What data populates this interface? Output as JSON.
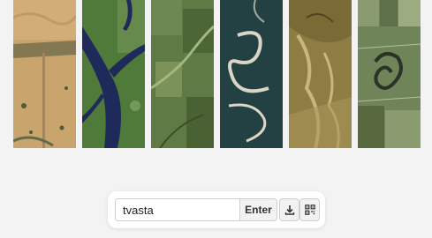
{
  "gallery": {
    "images": [
      {
        "name": "desert-sand-image",
        "colors": {
          "base": "#c9a46d",
          "dark": "#5e6b4a",
          "light": "#dfc293"
        }
      },
      {
        "name": "river-delta-image",
        "colors": {
          "base": "#4f7a3a",
          "dark": "#1e2b5a",
          "light": "#8fae6a"
        }
      },
      {
        "name": "green-fields-image",
        "colors": {
          "base": "#5f7a45",
          "dark": "#2f4a25",
          "light": "#a3b77f"
        }
      },
      {
        "name": "meandering-river-image",
        "colors": {
          "base": "#1f3a3d",
          "dark": "#0f2327",
          "light": "#d9d6c8"
        }
      },
      {
        "name": "canyon-terrain-image",
        "colors": {
          "base": "#8d7d43",
          "dark": "#4f4520",
          "light": "#c8b67d"
        }
      },
      {
        "name": "farmland-oxbow-image",
        "colors": {
          "base": "#6f8459",
          "dark": "#2b3226",
          "light": "#b4c29a"
        }
      }
    ]
  },
  "toolbar": {
    "search_value": "tvasta",
    "enter_label": "Enter",
    "download_icon": "download-icon",
    "qr_icon": "qr-code-icon"
  }
}
